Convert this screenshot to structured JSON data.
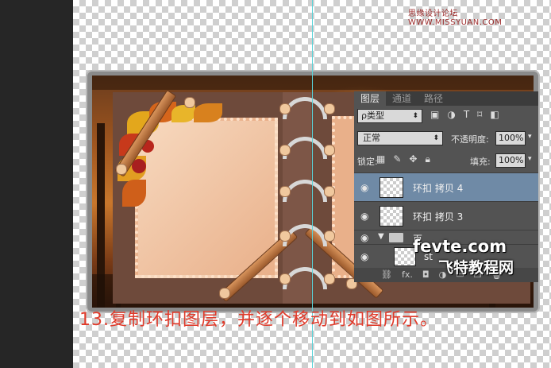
{
  "watermark_top": "思缘设计论坛  WWW.MISSYUAN.COM",
  "layers_panel": {
    "tabs": [
      {
        "label": "图层",
        "active": true
      },
      {
        "label": "通道",
        "active": false
      },
      {
        "label": "路径",
        "active": false
      }
    ],
    "filter_kind": "ρ类型",
    "blend_mode": "正常",
    "opacity_label": "不透明度:",
    "opacity_value": "100%",
    "lock_label": "锁定:",
    "fill_label": "填充:",
    "fill_value": "100%",
    "layers": [
      {
        "name": "环扣 拷贝 4",
        "selected": true,
        "type": "layer"
      },
      {
        "name": "环扣 拷贝 3",
        "selected": false,
        "type": "layer"
      },
      {
        "name": "页",
        "selected": false,
        "type": "group"
      },
      {
        "name": "st",
        "selected": false,
        "type": "layer"
      }
    ],
    "bottom_icons": [
      "link-icon",
      "fx-icon",
      "mask-icon",
      "adjustment-icon",
      "folder-icon",
      "new-layer-icon",
      "trash-icon"
    ],
    "bottom_fx": "fx."
  },
  "fevte_logo": "fevte.com",
  "fevte_logo_cn": "飞特教程网",
  "caption": "13.复制环扣图层，并逐个移动到如图所示。",
  "colors": {
    "selection": "#6f8aa6",
    "caption": "#e03a2a",
    "guide": "#5ad2d8"
  }
}
